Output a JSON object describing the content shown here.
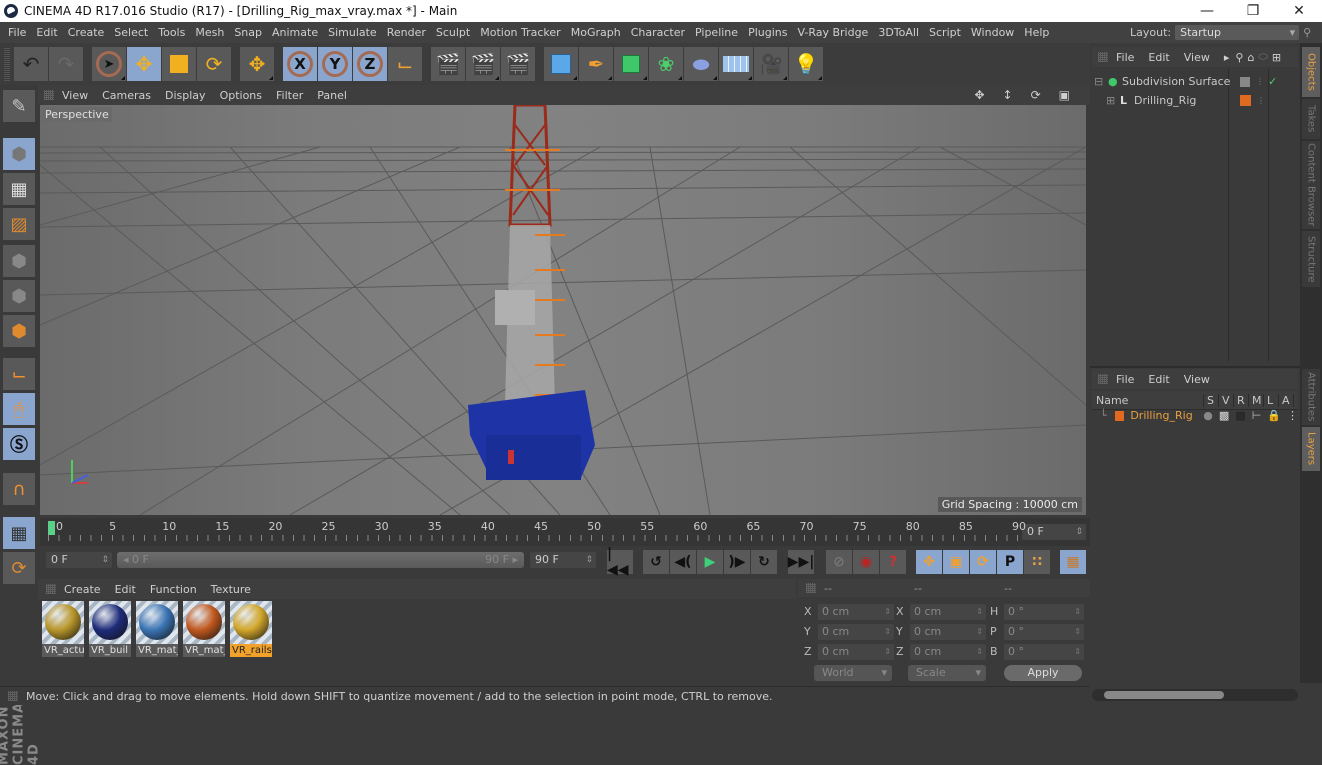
{
  "window": {
    "title": "CINEMA 4D R17.016 Studio (R17) - [Drilling_Rig_max_vray.max *] - Main",
    "controls": [
      "minimize",
      "restore",
      "close"
    ]
  },
  "menubar": {
    "items": [
      "File",
      "Edit",
      "Create",
      "Select",
      "Tools",
      "Mesh",
      "Snap",
      "Animate",
      "Simulate",
      "Render",
      "Sculpt",
      "Motion Tracker",
      "MoGraph",
      "Character",
      "Pipeline",
      "Plugins",
      "V-Ray Bridge",
      "3DToAll",
      "Script",
      "Window",
      "Help"
    ]
  },
  "layout": {
    "label": "Layout:",
    "value": "Startup"
  },
  "toolbar": {
    "icons": [
      "undo-icon",
      "redo-icon",
      "live-selection-icon",
      "move-icon",
      "scale-icon",
      "rotate-icon",
      "recent-tool-icon",
      "x-axis-lock-icon",
      "y-axis-lock-icon",
      "z-axis-lock-icon",
      "coordinate-system-icon",
      "render-view-icon",
      "render-picture-viewer-icon",
      "render-settings-icon",
      "cube-primitive-icon",
      "pen-spline-icon",
      "subdivision-generator-icon",
      "array-cloner-icon",
      "deformer-icon",
      "floor-environment-icon",
      "camera-icon",
      "light-icon"
    ],
    "axis_labels": [
      "X",
      "Y",
      "Z"
    ]
  },
  "left_toolbar": {
    "icons": [
      "make-editable-icon",
      "texture-mode-icon",
      "workplane-mode-icon",
      "points-mode-icon",
      "edges-mode-icon",
      "polygons-mode-icon",
      "axis-mode-icon",
      "tweak-mode-icon",
      "solo-mode-icon",
      "snap-magnet-icon",
      "workplane-lock-icon",
      "workplane-cycle-icon"
    ]
  },
  "branding": "MAXON CINEMA 4D",
  "viewport": {
    "menu": [
      "View",
      "Cameras",
      "Display",
      "Options",
      "Filter",
      "Panel"
    ],
    "camera_label": "Perspective",
    "grid_spacing": "Grid Spacing : 10000 cm",
    "nav_icons": [
      "pan-icon",
      "dolly-icon",
      "orbit-icon",
      "maximize-view-icon"
    ]
  },
  "timeline": {
    "ticks": [
      "0",
      "5",
      "10",
      "15",
      "20",
      "25",
      "30",
      "35",
      "40",
      "45",
      "50",
      "55",
      "60",
      "65",
      "70",
      "75",
      "80",
      "85",
      "90"
    ],
    "current_frame": "0 F",
    "start_frame": "0 F",
    "range_start": "0 F",
    "range_end": "90 F",
    "end_frame": "90 F"
  },
  "transport": {
    "icons": [
      "go-to-start-icon",
      "previous-key-icon",
      "previous-frame-icon",
      "play-icon",
      "next-frame-icon",
      "next-key-icon",
      "go-to-end-icon",
      "record-disabled-icon",
      "autokey-icon",
      "keyframe-selection-icon",
      "move-key-icon",
      "scale-key-icon",
      "rotate-key-icon",
      "param-key-icon",
      "point-level-icon",
      "timeline-icon"
    ]
  },
  "materials": {
    "menu": [
      "Create",
      "Edit",
      "Function",
      "Texture"
    ],
    "items": [
      {
        "name": "VR_actu",
        "color": "#b8962a",
        "selected": false
      },
      {
        "name": "VR_buil",
        "color": "#1e2c7a",
        "selected": false
      },
      {
        "name": "VR_mat_",
        "color": "#3a74b4",
        "selected": false
      },
      {
        "name": "VR_mat_",
        "color": "#c0581e",
        "selected": false
      },
      {
        "name": "VR_rails",
        "color": "#d1a62a",
        "selected": true
      }
    ]
  },
  "coordinates": {
    "headers": [
      "--",
      "--",
      "--"
    ],
    "rows": [
      {
        "l1": "X",
        "v1": "0 cm",
        "l2": "X",
        "v2": "0 cm",
        "l3": "H",
        "v3": "0 °"
      },
      {
        "l1": "Y",
        "v1": "0 cm",
        "l2": "Y",
        "v2": "0 cm",
        "l3": "P",
        "v3": "0 °"
      },
      {
        "l1": "Z",
        "v1": "0 cm",
        "l2": "Z",
        "v2": "0 cm",
        "l3": "B",
        "v3": "0 °"
      }
    ],
    "space": "World",
    "mode": "Scale",
    "apply": "Apply"
  },
  "object_manager": {
    "menu": [
      "File",
      "Edit",
      "View"
    ],
    "objects": [
      {
        "name": "Subdivision Surface",
        "icon": "subdivision-surface-icon",
        "enabled": true
      },
      {
        "name": "Drilling_Rig",
        "icon": "null-object-icon",
        "layer_color": "#e06a20"
      }
    ]
  },
  "layer_manager": {
    "menu": [
      "File",
      "Edit",
      "View"
    ],
    "columns": [
      "Name",
      "S",
      "V",
      "R",
      "M",
      "L",
      "A"
    ],
    "layers": [
      {
        "name": "Drilling_Rig",
        "color": "#e06a20"
      }
    ]
  },
  "side_tabs": {
    "top": [
      {
        "label": "Objects",
        "active": true
      },
      {
        "label": "Takes",
        "active": false
      },
      {
        "label": "Content Browser",
        "active": false
      },
      {
        "label": "Structure",
        "active": false
      }
    ],
    "bottom": [
      {
        "label": "Attributes",
        "active": false
      },
      {
        "label": "Layers",
        "active": true
      }
    ]
  },
  "status": "Move: Click and drag to move elements. Hold down SHIFT to quantize movement / add to the selection in point mode, CTRL to remove."
}
